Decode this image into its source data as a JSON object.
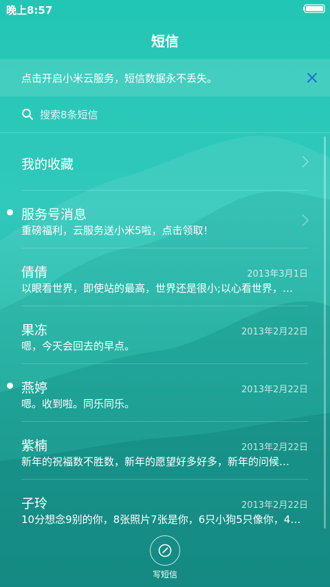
{
  "status_bar": {
    "time": "晚上8:57"
  },
  "header": {
    "title": "短信"
  },
  "banner": {
    "text": "点击开启小米云服务，短信数据永不丢失。"
  },
  "search": {
    "placeholder": "搜索8条短信"
  },
  "items": [
    {
      "name": "我的收藏",
      "snippet": "",
      "date": ""
    },
    {
      "name": "服务号消息",
      "snippet": "重磅福利，云服务送小米5啦，点击领取！",
      "date": ""
    },
    {
      "name": "倩倩",
      "snippet": "以眼看世界，即使站的最高，世界还是很小;以心看世界，…",
      "date": "2013年3月1日"
    },
    {
      "name": "果冻",
      "snippet": "嗯，今天会回去的早点。",
      "date": "2013年2月22日"
    },
    {
      "name": "燕婷",
      "snippet": "嗯。收到啦。同乐同乐。",
      "date": "2013年2月22日"
    },
    {
      "name": "紫楠",
      "snippet": "新年的祝福数不胜数，新年的愿望好多好多，新年的问候…",
      "date": "2013年2月22日"
    },
    {
      "name": "子玲",
      "snippet": "10分想念9别的你，8张照片7张是你，6只小狗5只像你，4…",
      "date": "2013年2月22日"
    }
  ],
  "compose": {
    "label": "写短信"
  }
}
